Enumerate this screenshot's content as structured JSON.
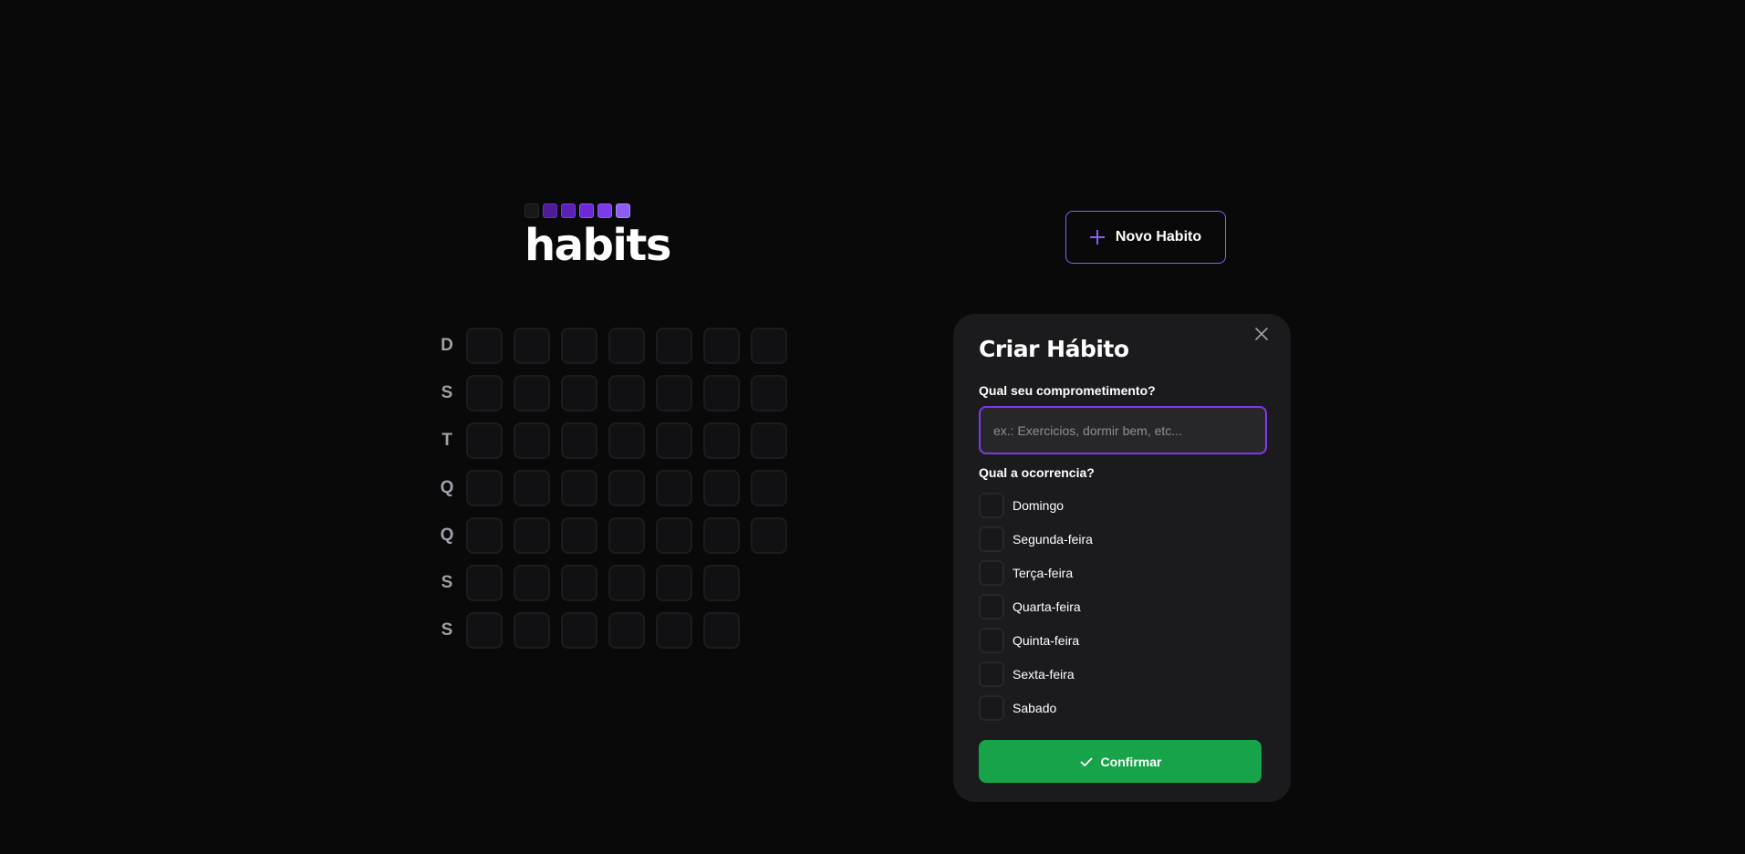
{
  "logo": {
    "title": "habits",
    "squares": [
      {
        "color": "#18181b",
        "border": "#27272a"
      },
      {
        "color": "#4c1d95",
        "border": "#6d28d9"
      },
      {
        "color": "#5b21b6",
        "border": "#7c3aed"
      },
      {
        "color": "#6d28d9",
        "border": "#8b5cf6"
      },
      {
        "color": "#7c3aed",
        "border": "#8b5cf6"
      },
      {
        "color": "#8b5cf6",
        "border": "#a78bfa"
      }
    ]
  },
  "header": {
    "new_habit_label": "Novo Habito",
    "new_habit_icon": "plus-icon",
    "accent_color": "#8b5cf6"
  },
  "summary": {
    "weekday_letters": [
      "D",
      "S",
      "T",
      "Q",
      "Q",
      "S",
      "S"
    ],
    "cells_per_row": [
      7,
      7,
      7,
      7,
      7,
      6,
      6
    ]
  },
  "modal": {
    "title": "Criar Hábito",
    "close_icon": "close-icon",
    "commitment_label": "Qual seu comprometimento?",
    "commitment_placeholder": "ex.: Exercicios, dormir bem, etc...",
    "commitment_value": "",
    "occurrence_label": "Qual a ocorrencia?",
    "days": [
      {
        "label": "Domingo",
        "checked": false
      },
      {
        "label": "Segunda-feira",
        "checked": false
      },
      {
        "label": "Terça-feira",
        "checked": false
      },
      {
        "label": "Quarta-feira",
        "checked": false
      },
      {
        "label": "Quinta-feira",
        "checked": false
      },
      {
        "label": "Sexta-feira",
        "checked": false
      },
      {
        "label": "Sabado",
        "checked": false
      }
    ],
    "confirm_label": "Confirmar",
    "confirm_icon": "check-icon",
    "confirm_color": "#16a34a"
  }
}
